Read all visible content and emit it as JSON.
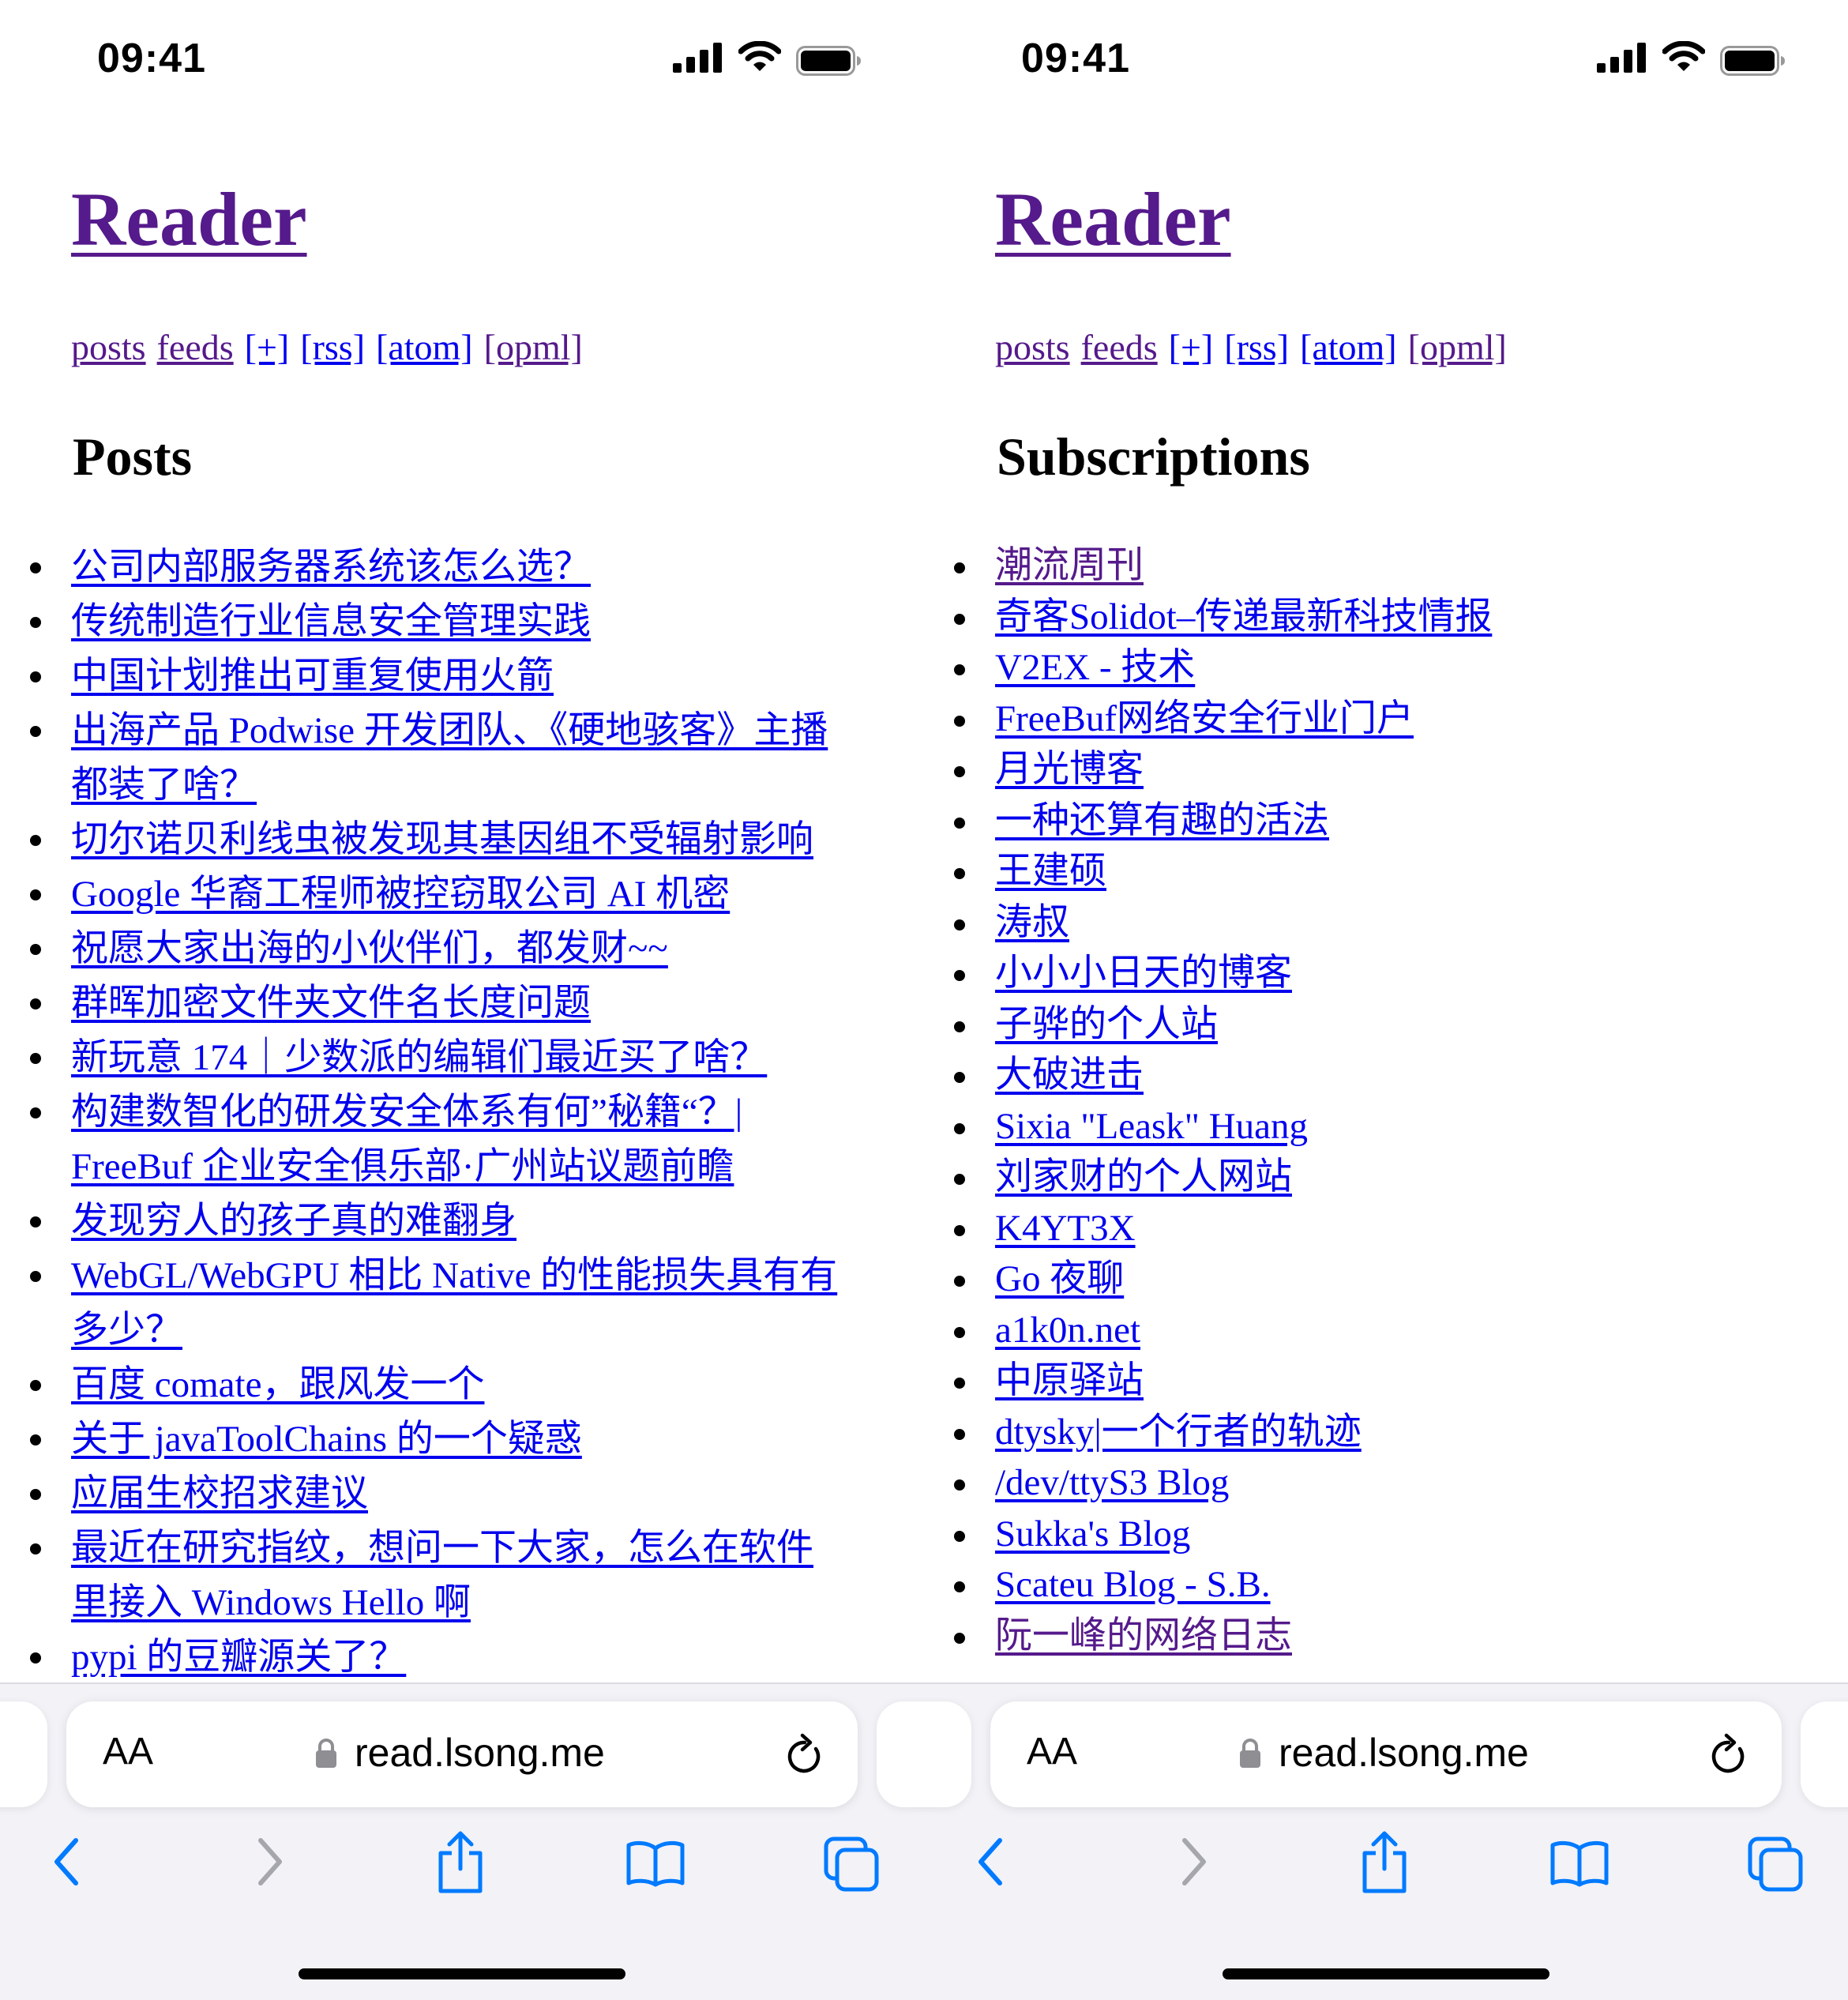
{
  "status_bar": {
    "time": "09:41"
  },
  "site": {
    "title": "Reader",
    "nav": [
      "posts",
      "feeds",
      "[+]",
      "[rss]",
      "[atom]",
      "[opml]"
    ]
  },
  "posts_screen": {
    "heading": "Posts",
    "items": [
      "公司内部服务器系统该怎么选？",
      "传统制造行业信息安全管理实践",
      "中国计划推出可重复使用火箭",
      "出海产品 Podwise 开发团队、《硬地骇客》主播都装了啥？",
      "切尔诺贝利线虫被发现其基因组不受辐射影响",
      "Google 华裔工程师被控窃取公司 AI 机密",
      "祝愿大家出海的小伙伴们，都发财~~",
      "群晖加密文件夹文件名长度问题",
      "新玩意 174｜少数派的编辑们最近买了啥？",
      "构建数智化的研发安全体系有何”秘籍“？| FreeBuf 企业安全俱乐部·广州站议题前瞻",
      "发现穷人的孩子真的难翻身",
      "WebGL/WebGPU 相比 Native 的性能损失具有有多少？",
      "百度 comate，跟风发一个",
      "关于 javaToolChains 的一个疑惑",
      "应届生校招求建议",
      "最近在研究指纹，想问一下大家，怎么在软件里接入 Windows Hello 啊",
      "pypi 的豆瓣源关了？"
    ]
  },
  "subscriptions_screen": {
    "heading": "Subscriptions",
    "items": [
      "潮流周刊",
      "奇客Solidot–传递最新科技情报",
      "V2EX - 技术",
      "FreeBuf网络安全行业门户",
      "月光博客",
      "一种还算有趣的活法",
      "王建硕",
      "涛叔",
      "小小小日天的博客",
      "子骅的个人站",
      "大破进击",
      "Sixia \"Leask\" Huang",
      "刘家财的个人网站",
      "K4YT3X",
      "Go 夜聊",
      "a1k0n.net",
      "中原驿站",
      "dtysky|一个行者的轨迹",
      "/dev/ttyS3 Blog",
      "Sukka's Blog",
      "Scateu Blog - S.B.",
      "阮一峰的网络日志"
    ],
    "visited_items": [
      "潮流周刊",
      "阮一峰的网络日志"
    ]
  },
  "browser": {
    "aa_label": "AA",
    "url": "read.lsong.me",
    "icons": [
      "lock-icon",
      "reload-icon",
      "back-icon",
      "forward-icon",
      "share-icon",
      "bookmarks-icon",
      "tabs-icon"
    ]
  },
  "colors": {
    "visited_link": "#551a8b",
    "link": "#0000ee",
    "toolbar_tint": "#007aff",
    "toolbar_bg": "#f2f2f7"
  }
}
